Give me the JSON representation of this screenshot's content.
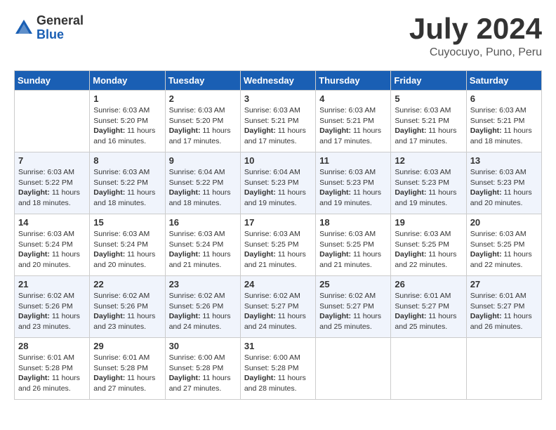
{
  "header": {
    "logo_general": "General",
    "logo_blue": "Blue",
    "month_title": "July 2024",
    "subtitle": "Cuyocuyo, Puno, Peru"
  },
  "days_of_week": [
    "Sunday",
    "Monday",
    "Tuesday",
    "Wednesday",
    "Thursday",
    "Friday",
    "Saturday"
  ],
  "weeks": [
    [
      {
        "day": "",
        "sunrise": "",
        "sunset": "",
        "daylight": ""
      },
      {
        "day": "1",
        "sunrise": "Sunrise: 6:03 AM",
        "sunset": "Sunset: 5:20 PM",
        "daylight": "Daylight: 11 hours and 16 minutes."
      },
      {
        "day": "2",
        "sunrise": "Sunrise: 6:03 AM",
        "sunset": "Sunset: 5:20 PM",
        "daylight": "Daylight: 11 hours and 17 minutes."
      },
      {
        "day": "3",
        "sunrise": "Sunrise: 6:03 AM",
        "sunset": "Sunset: 5:21 PM",
        "daylight": "Daylight: 11 hours and 17 minutes."
      },
      {
        "day": "4",
        "sunrise": "Sunrise: 6:03 AM",
        "sunset": "Sunset: 5:21 PM",
        "daylight": "Daylight: 11 hours and 17 minutes."
      },
      {
        "day": "5",
        "sunrise": "Sunrise: 6:03 AM",
        "sunset": "Sunset: 5:21 PM",
        "daylight": "Daylight: 11 hours and 17 minutes."
      },
      {
        "day": "6",
        "sunrise": "Sunrise: 6:03 AM",
        "sunset": "Sunset: 5:21 PM",
        "daylight": "Daylight: 11 hours and 18 minutes."
      }
    ],
    [
      {
        "day": "7",
        "sunrise": "Sunrise: 6:03 AM",
        "sunset": "Sunset: 5:22 PM",
        "daylight": "Daylight: 11 hours and 18 minutes."
      },
      {
        "day": "8",
        "sunrise": "Sunrise: 6:03 AM",
        "sunset": "Sunset: 5:22 PM",
        "daylight": "Daylight: 11 hours and 18 minutes."
      },
      {
        "day": "9",
        "sunrise": "Sunrise: 6:04 AM",
        "sunset": "Sunset: 5:22 PM",
        "daylight": "Daylight: 11 hours and 18 minutes."
      },
      {
        "day": "10",
        "sunrise": "Sunrise: 6:04 AM",
        "sunset": "Sunset: 5:23 PM",
        "daylight": "Daylight: 11 hours and 19 minutes."
      },
      {
        "day": "11",
        "sunrise": "Sunrise: 6:03 AM",
        "sunset": "Sunset: 5:23 PM",
        "daylight": "Daylight: 11 hours and 19 minutes."
      },
      {
        "day": "12",
        "sunrise": "Sunrise: 6:03 AM",
        "sunset": "Sunset: 5:23 PM",
        "daylight": "Daylight: 11 hours and 19 minutes."
      },
      {
        "day": "13",
        "sunrise": "Sunrise: 6:03 AM",
        "sunset": "Sunset: 5:23 PM",
        "daylight": "Daylight: 11 hours and 20 minutes."
      }
    ],
    [
      {
        "day": "14",
        "sunrise": "Sunrise: 6:03 AM",
        "sunset": "Sunset: 5:24 PM",
        "daylight": "Daylight: 11 hours and 20 minutes."
      },
      {
        "day": "15",
        "sunrise": "Sunrise: 6:03 AM",
        "sunset": "Sunset: 5:24 PM",
        "daylight": "Daylight: 11 hours and 20 minutes."
      },
      {
        "day": "16",
        "sunrise": "Sunrise: 6:03 AM",
        "sunset": "Sunset: 5:24 PM",
        "daylight": "Daylight: 11 hours and 21 minutes."
      },
      {
        "day": "17",
        "sunrise": "Sunrise: 6:03 AM",
        "sunset": "Sunset: 5:25 PM",
        "daylight": "Daylight: 11 hours and 21 minutes."
      },
      {
        "day": "18",
        "sunrise": "Sunrise: 6:03 AM",
        "sunset": "Sunset: 5:25 PM",
        "daylight": "Daylight: 11 hours and 21 minutes."
      },
      {
        "day": "19",
        "sunrise": "Sunrise: 6:03 AM",
        "sunset": "Sunset: 5:25 PM",
        "daylight": "Daylight: 11 hours and 22 minutes."
      },
      {
        "day": "20",
        "sunrise": "Sunrise: 6:03 AM",
        "sunset": "Sunset: 5:25 PM",
        "daylight": "Daylight: 11 hours and 22 minutes."
      }
    ],
    [
      {
        "day": "21",
        "sunrise": "Sunrise: 6:02 AM",
        "sunset": "Sunset: 5:26 PM",
        "daylight": "Daylight: 11 hours and 23 minutes."
      },
      {
        "day": "22",
        "sunrise": "Sunrise: 6:02 AM",
        "sunset": "Sunset: 5:26 PM",
        "daylight": "Daylight: 11 hours and 23 minutes."
      },
      {
        "day": "23",
        "sunrise": "Sunrise: 6:02 AM",
        "sunset": "Sunset: 5:26 PM",
        "daylight": "Daylight: 11 hours and 24 minutes."
      },
      {
        "day": "24",
        "sunrise": "Sunrise: 6:02 AM",
        "sunset": "Sunset: 5:27 PM",
        "daylight": "Daylight: 11 hours and 24 minutes."
      },
      {
        "day": "25",
        "sunrise": "Sunrise: 6:02 AM",
        "sunset": "Sunset: 5:27 PM",
        "daylight": "Daylight: 11 hours and 25 minutes."
      },
      {
        "day": "26",
        "sunrise": "Sunrise: 6:01 AM",
        "sunset": "Sunset: 5:27 PM",
        "daylight": "Daylight: 11 hours and 25 minutes."
      },
      {
        "day": "27",
        "sunrise": "Sunrise: 6:01 AM",
        "sunset": "Sunset: 5:27 PM",
        "daylight": "Daylight: 11 hours and 26 minutes."
      }
    ],
    [
      {
        "day": "28",
        "sunrise": "Sunrise: 6:01 AM",
        "sunset": "Sunset: 5:28 PM",
        "daylight": "Daylight: 11 hours and 26 minutes."
      },
      {
        "day": "29",
        "sunrise": "Sunrise: 6:01 AM",
        "sunset": "Sunset: 5:28 PM",
        "daylight": "Daylight: 11 hours and 27 minutes."
      },
      {
        "day": "30",
        "sunrise": "Sunrise: 6:00 AM",
        "sunset": "Sunset: 5:28 PM",
        "daylight": "Daylight: 11 hours and 27 minutes."
      },
      {
        "day": "31",
        "sunrise": "Sunrise: 6:00 AM",
        "sunset": "Sunset: 5:28 PM",
        "daylight": "Daylight: 11 hours and 28 minutes."
      },
      {
        "day": "",
        "sunrise": "",
        "sunset": "",
        "daylight": ""
      },
      {
        "day": "",
        "sunrise": "",
        "sunset": "",
        "daylight": ""
      },
      {
        "day": "",
        "sunrise": "",
        "sunset": "",
        "daylight": ""
      }
    ]
  ]
}
